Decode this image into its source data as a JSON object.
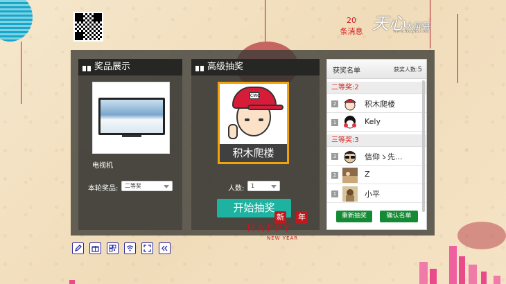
{
  "header": {
    "message_count": "20",
    "message_label": "条消息",
    "logo_big": "天心",
    "logo_text": "大屏幕",
    "logo_site": "www.ltxcpm.com"
  },
  "prize_panel": {
    "title": "奖品展示",
    "prize_name": "电视机",
    "round_prize_label": "本轮奖品:",
    "round_prize_value": "二等奖"
  },
  "lottery_panel": {
    "title": "高级抽奖",
    "current_name": "积木爬楼",
    "cap_text": "CWC",
    "count_label": "人数:",
    "count_value": "1",
    "start_button": "开始抽奖"
  },
  "winners": {
    "title": "获奖名单",
    "count_label": "获奖人数:",
    "count_value": "5",
    "tiers": [
      {
        "label": "二等奖:2",
        "entries": [
          {
            "rank": "2",
            "name": "积木爬楼"
          },
          {
            "rank": "1",
            "name": "Kely"
          }
        ]
      },
      {
        "label": "三等奖:3",
        "entries": [
          {
            "rank": "3",
            "name": "信仰ゝ先..."
          },
          {
            "rank": "2",
            "name": "Z"
          },
          {
            "rank": "1",
            "name": "小平"
          }
        ]
      }
    ],
    "reset_button": "重新抽奖",
    "confirm_button": "确认名单"
  },
  "toolbar": {
    "icons": [
      "edit-icon",
      "gift-icon",
      "qrcode-icon",
      "wifi-icon",
      "fullscreen-icon",
      "collapse-icon"
    ]
  },
  "decoration": {
    "happy_text": "HAPPY",
    "new_year_text": "NEW YEAR",
    "seal_1": "新",
    "seal_2": "年"
  },
  "colors": {
    "accent_teal": "#1eb2a0",
    "highlight_orange": "#f2a20b",
    "tier_red": "#d9221c",
    "button_green": "#158a34",
    "message_red": "#d4161d"
  }
}
